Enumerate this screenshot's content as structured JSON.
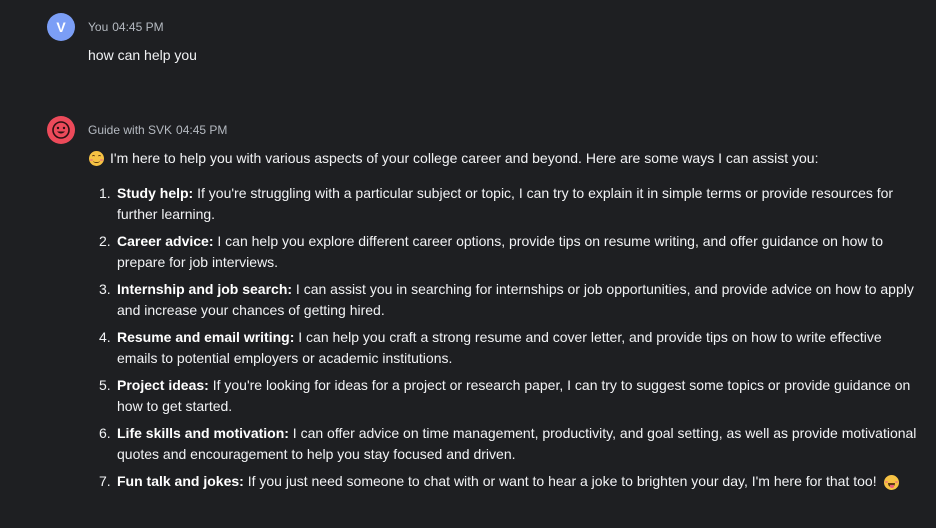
{
  "messages": [
    {
      "avatar_letter": "V",
      "author": "You",
      "time": "04:45 PM",
      "text": "how can help you"
    },
    {
      "author": "Guide with SVK",
      "time": "04:45 PM",
      "intro": "I'm here to help you with various aspects of your college career and beyond. Here are some ways I can assist you:",
      "items": [
        {
          "num": "1.",
          "title": "Study help:",
          "text": " If you're struggling with a particular subject or topic, I can try to explain it in simple terms or provide resources for further learning."
        },
        {
          "num": "2.",
          "title": "Career advice:",
          "text": " I can help you explore different career options, provide tips on resume writing, and offer guidance on how to prepare for job interviews."
        },
        {
          "num": "3.",
          "title": "Internship and job search:",
          "text": " I can assist you in searching for internships or job opportunities, and provide advice on how to apply and increase your chances of getting hired."
        },
        {
          "num": "4.",
          "title": "Resume and email writing:",
          "text": " I can help you craft a strong resume and cover letter, and provide tips on how to write effective emails to potential employers or academic institutions."
        },
        {
          "num": "5.",
          "title": "Project ideas:",
          "text": " If you're looking for ideas for a project or research paper, I can try to suggest some topics or provide guidance on how to get started."
        },
        {
          "num": "6.",
          "title": "Life skills and motivation:",
          "text": " I can offer advice on time management, productivity, and goal setting, as well as provide motivational quotes and encouragement to help you stay focused and driven."
        },
        {
          "num": "7.",
          "title": "Fun talk and jokes:",
          "text": " If you just need someone to chat with or want to hear a joke to brighten your day, I'm here for that too!"
        }
      ]
    }
  ],
  "icons": {
    "bot_avatar": "smiley-face-icon",
    "intro_emoji": "smiling-face-icon",
    "closing_emoji": "grinning-tongue-icon"
  },
  "colors": {
    "background": "#1e1f22",
    "user_avatar": "#7b9ef6",
    "bot_avatar": "#ec4a5a"
  }
}
